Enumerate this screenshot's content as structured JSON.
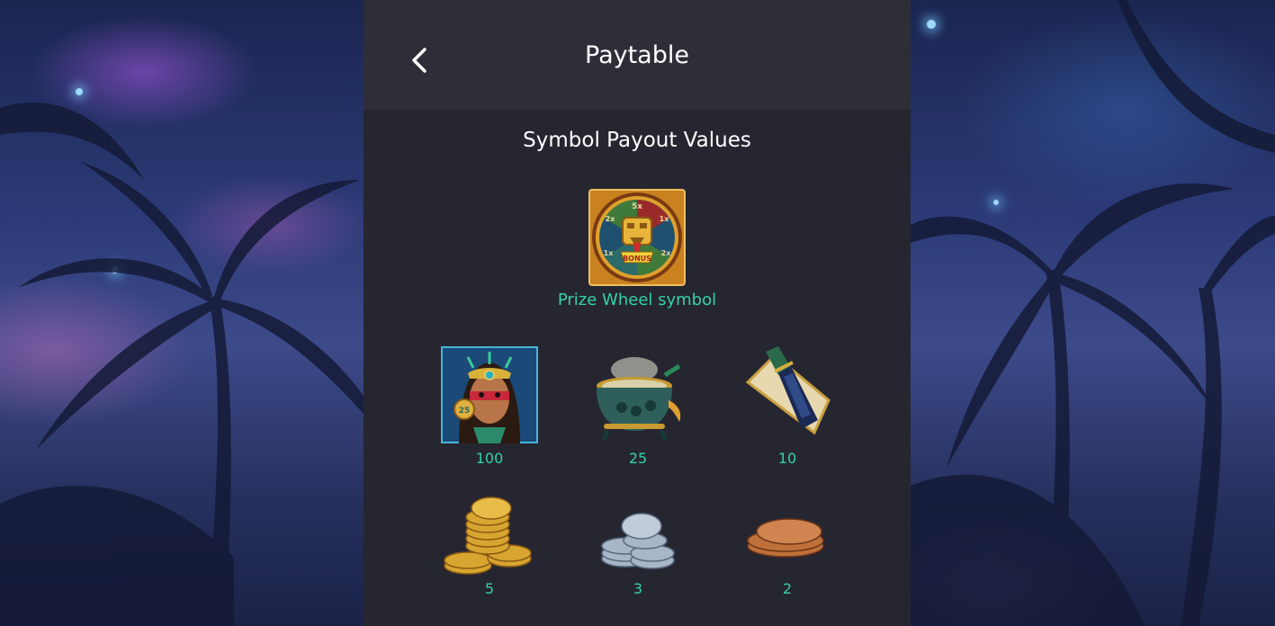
{
  "header": {
    "title": "Paytable",
    "back_icon": "chevron-left-icon"
  },
  "section": {
    "title": "Symbol Payout Values"
  },
  "feature_symbol": {
    "label": "Prize Wheel symbol",
    "icon": "prize-wheel-icon",
    "wheel_labels": [
      "5x",
      "1x",
      "2x",
      "1x",
      "2x"
    ],
    "bonus_text": "BONUS"
  },
  "symbols": [
    {
      "icon": "warrior-woman-icon",
      "value": "100"
    },
    {
      "icon": "cauldron-icon",
      "value": "25"
    },
    {
      "icon": "obsidian-dagger-icon",
      "value": "10"
    },
    {
      "icon": "gold-coins-icon",
      "value": "5"
    },
    {
      "icon": "silver-coins-icon",
      "value": "3"
    },
    {
      "icon": "bronze-coins-icon",
      "value": "2"
    }
  ],
  "colors": {
    "accent": "#34d3a5",
    "panel": "#262631",
    "header": "#2e2e39"
  }
}
